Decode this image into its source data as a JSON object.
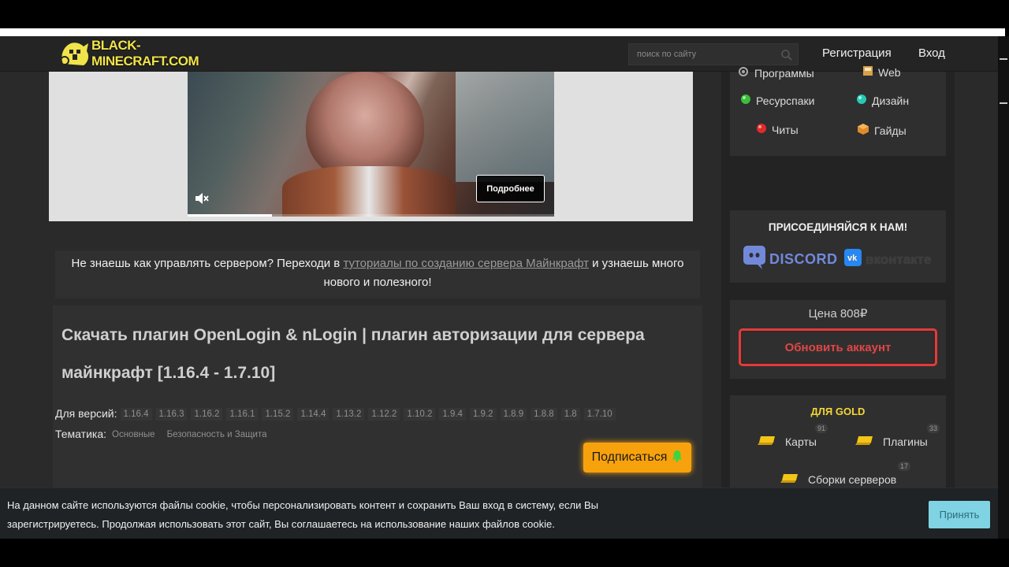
{
  "header": {
    "logo_text": "BLACK-MINECRAFT.COM",
    "search_placeholder": "поиск по сайту",
    "register": "Регистрация",
    "login": "Вход"
  },
  "video": {
    "more_label": "Подробнее",
    "progress_fraction": 0.23
  },
  "notice": {
    "before": "Не знаешь как управлять сервером? Переходи в ",
    "link": "туториалы по созданию сервера Майнкрафт",
    "after": " и узнаешь много нового и полезного!"
  },
  "article": {
    "title": "Скачать плагин OpenLogin & nLogin | плагин авторизации для сервера майнкрафт [1.16.4 - 1.7.10]",
    "versions_label": "Для версий:",
    "versions": [
      "1.16.4",
      "1.16.3",
      "1.16.2",
      "1.16.1",
      "1.15.2",
      "1.14.4",
      "1.13.2",
      "1.12.2",
      "1.10.2",
      "1.9.4",
      "1.9.2",
      "1.8.9",
      "1.8.8",
      "1.8",
      "1.7.10"
    ],
    "topic_label": "Тематика:",
    "topics": [
      "Основные",
      "Безопасность и Защита"
    ],
    "subscribe_label": "Подписаться"
  },
  "sidebar": {
    "categories": [
      {
        "label": "Программы",
        "icon": "programs-icon"
      },
      {
        "label": "Web",
        "icon": "web-icon"
      },
      {
        "label": "Ресурспаки",
        "icon": "resourcepacks-icon"
      },
      {
        "label": "Дизайн",
        "icon": "design-icon"
      },
      {
        "label": "Читы",
        "icon": "cheats-icon"
      },
      {
        "label": "Гайды",
        "icon": "guides-icon"
      }
    ],
    "join_title": "ПРИСОЕДИНЯЙСЯ К НАМ!",
    "discord_label": "DISCORD",
    "vk_label": "вконтакте",
    "price": "Цена 808₽",
    "update_label": "Обновить аккаунт",
    "gold_title": "ДЛЯ GOLD",
    "gold_items": [
      {
        "label": "Карты",
        "count": "91"
      },
      {
        "label": "Плагины",
        "count": "33"
      },
      {
        "label": "Сборки серверов",
        "count": "17"
      }
    ]
  },
  "cookie": {
    "text": "На данном сайте используются файлы cookie, чтобы персонализировать контент и сохранить Ваш вход в систему, если Вы зарегистрируетесь. Продолжая использовать этот сайт, Вы соглашаетесь на использование наших файлов cookie.",
    "accept": "Принять"
  },
  "colors": {
    "logo_yellow": "#f1e44a",
    "subscribe_orange": "#f7a20d",
    "update_red": "#e03c3c",
    "gold_yellow": "#f4d735",
    "discord_blue": "#7289da",
    "accept_cyan": "#7fd3e3"
  }
}
